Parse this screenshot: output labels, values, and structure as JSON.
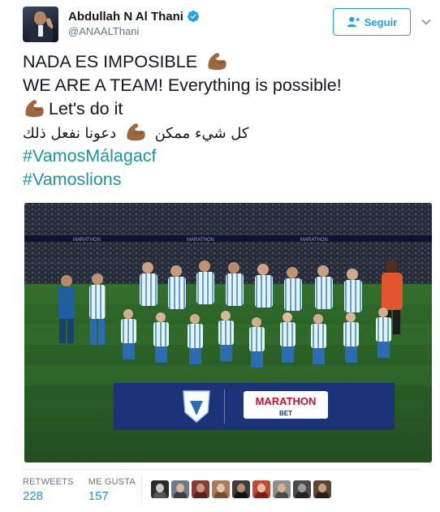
{
  "user": {
    "name": "Abdullah N Al Thani",
    "handle": "@ANAALThani",
    "verified": true
  },
  "follow_button": {
    "label": "Seguir",
    "icon": "add-user-icon"
  },
  "menu_icon": "chevron-down-icon",
  "tweet": {
    "line1": "NADA ES IMPOSIBLE",
    "line2": "WE ARE A TEAM!  Everything is possible!",
    "line3": "Let's do it",
    "line4_arabic_a": "كل شيء ممكن",
    "line4_arabic_b": "دعونا نفعل ذلك",
    "hashtag1": "#VamosMálagacf",
    "hashtag2": "#Vamoslions",
    "emoji": "flexed-biceps-icon"
  },
  "photo": {
    "banner_brand": "MARATHON",
    "banner_sub": "BET"
  },
  "stats": {
    "retweets_label": "RETWEETS",
    "retweets_value": "228",
    "likes_label": "ME GUSTA",
    "likes_value": "157"
  },
  "colors": {
    "link": "#1b95a0",
    "accent": "#1da1f2",
    "stat_value": "#1b95e0",
    "muted": "#657786"
  }
}
